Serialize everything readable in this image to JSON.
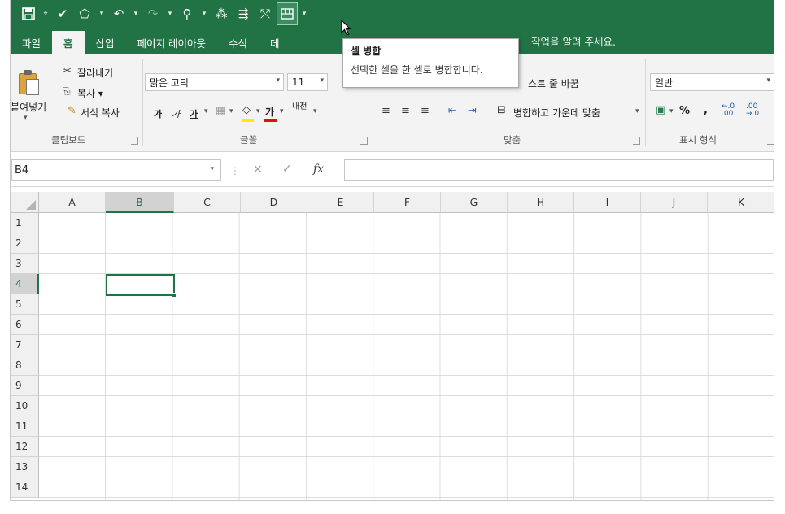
{
  "qat": {
    "items": [
      "save-icon",
      "pin-icon",
      "format-painter-icon",
      "shape-icon",
      "undo-icon",
      "redo-icon",
      "find-icon",
      "connector-icon",
      "flow-icon",
      "remove-link-icon",
      "merge-cells-icon",
      "customize-icon"
    ]
  },
  "tabs": [
    "파일",
    "홈",
    "삽입",
    "페이지 레이아웃",
    "수식",
    "데"
  ],
  "active_tab": "홈",
  "tellme": "작업을 알려 주세요.",
  "ribbon": {
    "clipboard": {
      "paste": "붙여넣기",
      "cut": "잘라내기",
      "copy": "복사 ▾",
      "format_painter": "서식 복사",
      "label": "클립보드"
    },
    "font": {
      "name": "맑은 고딕",
      "size": "11",
      "bold": "가",
      "italic": "가",
      "underline": "가",
      "phonetic": "내천",
      "label": "글꼴"
    },
    "alignment": {
      "wrap": "스트 줄 바꿈",
      "merge": "병합하고 가운데 맞춤",
      "label": "맞춤"
    },
    "number": {
      "format": "일반",
      "percent": "%",
      "comma": ",",
      "label": "표시 형식"
    }
  },
  "tooltip": {
    "title": "셀 병합",
    "description": "선택한 셀을 한 셀로 병합합니다."
  },
  "formula_bar": {
    "name_box": "B4",
    "cancel": "×",
    "enter": "✓",
    "fx": "fx",
    "value": ""
  },
  "grid": {
    "columns": [
      "A",
      "B",
      "C",
      "D",
      "E",
      "F",
      "G",
      "H",
      "I",
      "J",
      "K"
    ],
    "rows": [
      "1",
      "2",
      "3",
      "4",
      "5",
      "6",
      "7",
      "8",
      "9",
      "10",
      "11",
      "12",
      "13",
      "14"
    ],
    "selected_cell": "B4",
    "selected_column": "B",
    "selected_row": "4"
  },
  "colors": {
    "accent": "#217346",
    "ribbon_bg": "#f3f3f3"
  }
}
